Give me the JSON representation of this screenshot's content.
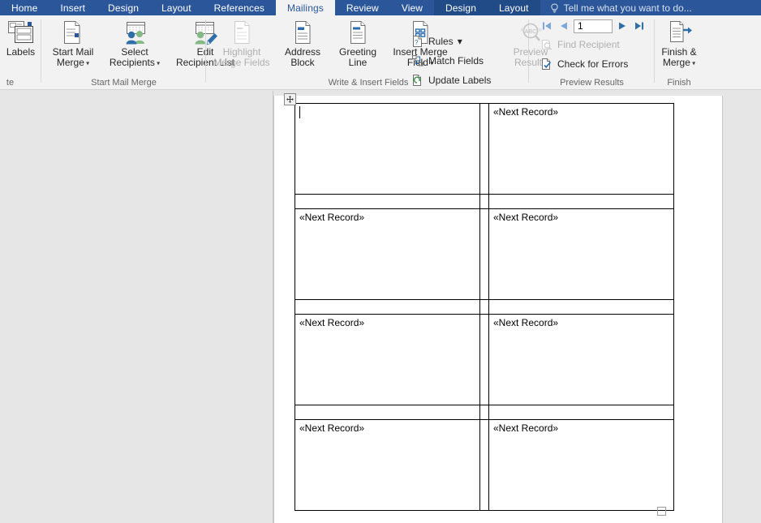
{
  "tabs": [
    {
      "label": "Home",
      "state": "normal"
    },
    {
      "label": "Insert",
      "state": "normal"
    },
    {
      "label": "Design",
      "state": "normal"
    },
    {
      "label": "Layout",
      "state": "normal"
    },
    {
      "label": "References",
      "state": "normal"
    },
    {
      "label": "Mailings",
      "state": "active"
    },
    {
      "label": "Review",
      "state": "normal"
    },
    {
      "label": "View",
      "state": "normal"
    },
    {
      "label": "Design",
      "state": "contextual"
    },
    {
      "label": "Layout",
      "state": "contextual"
    }
  ],
  "tell_me": {
    "text": "Tell me what you want to do...",
    "icon": "lightbulb-icon"
  },
  "ribbon": {
    "groups": [
      {
        "name": "create",
        "label": "te",
        "buttons": [
          {
            "label": "Labels",
            "icon": "labels-icon",
            "disabled": false,
            "dropdown": false
          }
        ]
      },
      {
        "name": "start-mail-merge",
        "label": "Start Mail Merge",
        "buttons": [
          {
            "label": "Start Mail\nMerge",
            "icon": "start-mail-merge-icon",
            "disabled": false,
            "dropdown": true
          },
          {
            "label": "Select\nRecipients",
            "icon": "select-recipients-icon",
            "disabled": false,
            "dropdown": true
          },
          {
            "label": "Edit\nRecipient List",
            "icon": "edit-recipient-list-icon",
            "disabled": false,
            "dropdown": false
          }
        ]
      },
      {
        "name": "write-insert-fields",
        "label": "Write & Insert Fields",
        "buttons": [
          {
            "label": "Highlight\nMerge Fields",
            "icon": "highlight-merge-fields-icon",
            "disabled": true,
            "dropdown": false
          },
          {
            "label": "Address\nBlock",
            "icon": "address-block-icon",
            "disabled": false,
            "dropdown": false
          },
          {
            "label": "Greeting\nLine",
            "icon": "greeting-line-icon",
            "disabled": false,
            "dropdown": false
          },
          {
            "label": "Insert Merge\nField",
            "icon": "insert-merge-field-icon",
            "disabled": false,
            "dropdown": true
          }
        ],
        "small_buttons": [
          {
            "label": "Rules",
            "icon": "rules-icon",
            "disabled": false,
            "dropdown": true
          },
          {
            "label": "Match Fields",
            "icon": "match-fields-icon",
            "disabled": false,
            "dropdown": false
          },
          {
            "label": "Update Labels",
            "icon": "update-labels-icon",
            "disabled": false,
            "dropdown": false
          }
        ]
      },
      {
        "name": "preview-results",
        "label": "Preview Results",
        "buttons": [
          {
            "label": "Preview\nResults",
            "icon": "preview-results-icon",
            "disabled": true,
            "dropdown": false
          }
        ],
        "small_buttons": [
          {
            "label": "Find Recipient",
            "icon": "find-recipient-icon",
            "disabled": true,
            "dropdown": false
          },
          {
            "label": "Check for Errors",
            "icon": "check-for-errors-icon",
            "disabled": false,
            "dropdown": false
          }
        ],
        "record_nav": {
          "first_label": "first-record",
          "previous_label": "previous-record",
          "next_label": "next-record",
          "last_label": "last-record",
          "value": "1"
        }
      },
      {
        "name": "finish",
        "label": "Finish",
        "buttons": [
          {
            "label": "Finish &\nMerge",
            "icon": "finish-merge-icon",
            "disabled": false,
            "dropdown": true
          }
        ]
      }
    ]
  },
  "document": {
    "table": {
      "next_record_text": "«Next Record»",
      "rows": [
        {
          "type": "labels",
          "cells": [
            "",
            "«Next Record»"
          ]
        },
        {
          "type": "gutter",
          "cells": [
            "",
            ""
          ]
        },
        {
          "type": "labels",
          "cells": [
            "«Next Record»",
            "«Next Record»"
          ]
        },
        {
          "type": "gutter",
          "cells": [
            "",
            ""
          ]
        },
        {
          "type": "labels",
          "cells": [
            "«Next Record»",
            "«Next Record»"
          ]
        },
        {
          "type": "gutter",
          "cells": [
            "",
            ""
          ]
        },
        {
          "type": "labels",
          "cells": [
            "«Next Record»",
            "«Next Record»"
          ]
        }
      ]
    },
    "move_handle_icon": "table-move-handle-icon",
    "resize_handle_icon": "table-resize-handle-icon",
    "cursor_in_cell": "r0c0"
  },
  "colors": {
    "ribbon_blue": "#2b579a",
    "contextual_blue": "#204b86",
    "ribbon_bg": "#f2f2f2",
    "workspace_bg": "#e6e6e6",
    "page_bg": "#ffffff",
    "accent_icon_blue": "#2b579a",
    "accent_green": "#5a9a68",
    "disabled_text": "#b0b0b0"
  }
}
